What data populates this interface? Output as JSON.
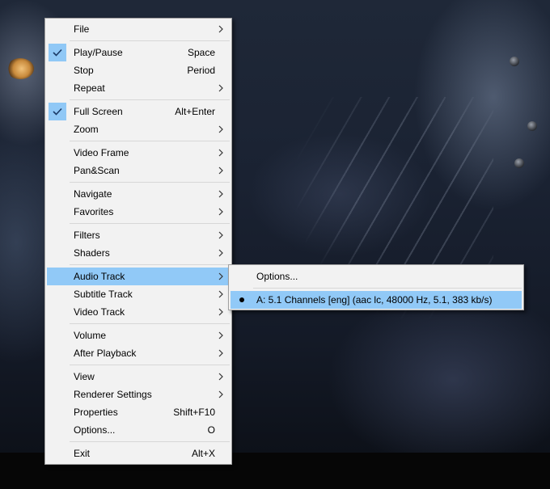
{
  "main_menu": {
    "items": [
      {
        "label": "File",
        "shortcut": "",
        "submenu": true,
        "checked": false
      },
      {
        "label": "Play/Pause",
        "shortcut": "Space",
        "submenu": false,
        "checked": true
      },
      {
        "label": "Stop",
        "shortcut": "Period",
        "submenu": false,
        "checked": false
      },
      {
        "label": "Repeat",
        "shortcut": "",
        "submenu": true,
        "checked": false
      },
      {
        "label": "Full Screen",
        "shortcut": "Alt+Enter",
        "submenu": false,
        "checked": true
      },
      {
        "label": "Zoom",
        "shortcut": "",
        "submenu": true,
        "checked": false
      },
      {
        "label": "Video Frame",
        "shortcut": "",
        "submenu": true,
        "checked": false
      },
      {
        "label": "Pan&Scan",
        "shortcut": "",
        "submenu": true,
        "checked": false
      },
      {
        "label": "Navigate",
        "shortcut": "",
        "submenu": true,
        "checked": false
      },
      {
        "label": "Favorites",
        "shortcut": "",
        "submenu": true,
        "checked": false
      },
      {
        "label": "Filters",
        "shortcut": "",
        "submenu": true,
        "checked": false
      },
      {
        "label": "Shaders",
        "shortcut": "",
        "submenu": true,
        "checked": false
      },
      {
        "label": "Audio Track",
        "shortcut": "",
        "submenu": true,
        "checked": false,
        "highlighted": true
      },
      {
        "label": "Subtitle Track",
        "shortcut": "",
        "submenu": true,
        "checked": false
      },
      {
        "label": "Video Track",
        "shortcut": "",
        "submenu": true,
        "checked": false
      },
      {
        "label": "Volume",
        "shortcut": "",
        "submenu": true,
        "checked": false
      },
      {
        "label": "After Playback",
        "shortcut": "",
        "submenu": true,
        "checked": false
      },
      {
        "label": "View",
        "shortcut": "",
        "submenu": true,
        "checked": false
      },
      {
        "label": "Renderer Settings",
        "shortcut": "",
        "submenu": true,
        "checked": false
      },
      {
        "label": "Properties",
        "shortcut": "Shift+F10",
        "submenu": false,
        "checked": false
      },
      {
        "label": "Options...",
        "shortcut": "O",
        "submenu": false,
        "checked": false
      },
      {
        "label": "Exit",
        "shortcut": "Alt+X",
        "submenu": false,
        "checked": false
      }
    ]
  },
  "audio_track_menu": {
    "options_label": "Options...",
    "track_label": "A: 5.1 Channels [eng] (aac lc, 48000 Hz, 5.1, 383 kb/s)",
    "track_selected": true
  },
  "colors": {
    "menu_bg": "#f2f2f2",
    "highlight": "#91c9f7",
    "check_bg": "#90c8f6"
  }
}
